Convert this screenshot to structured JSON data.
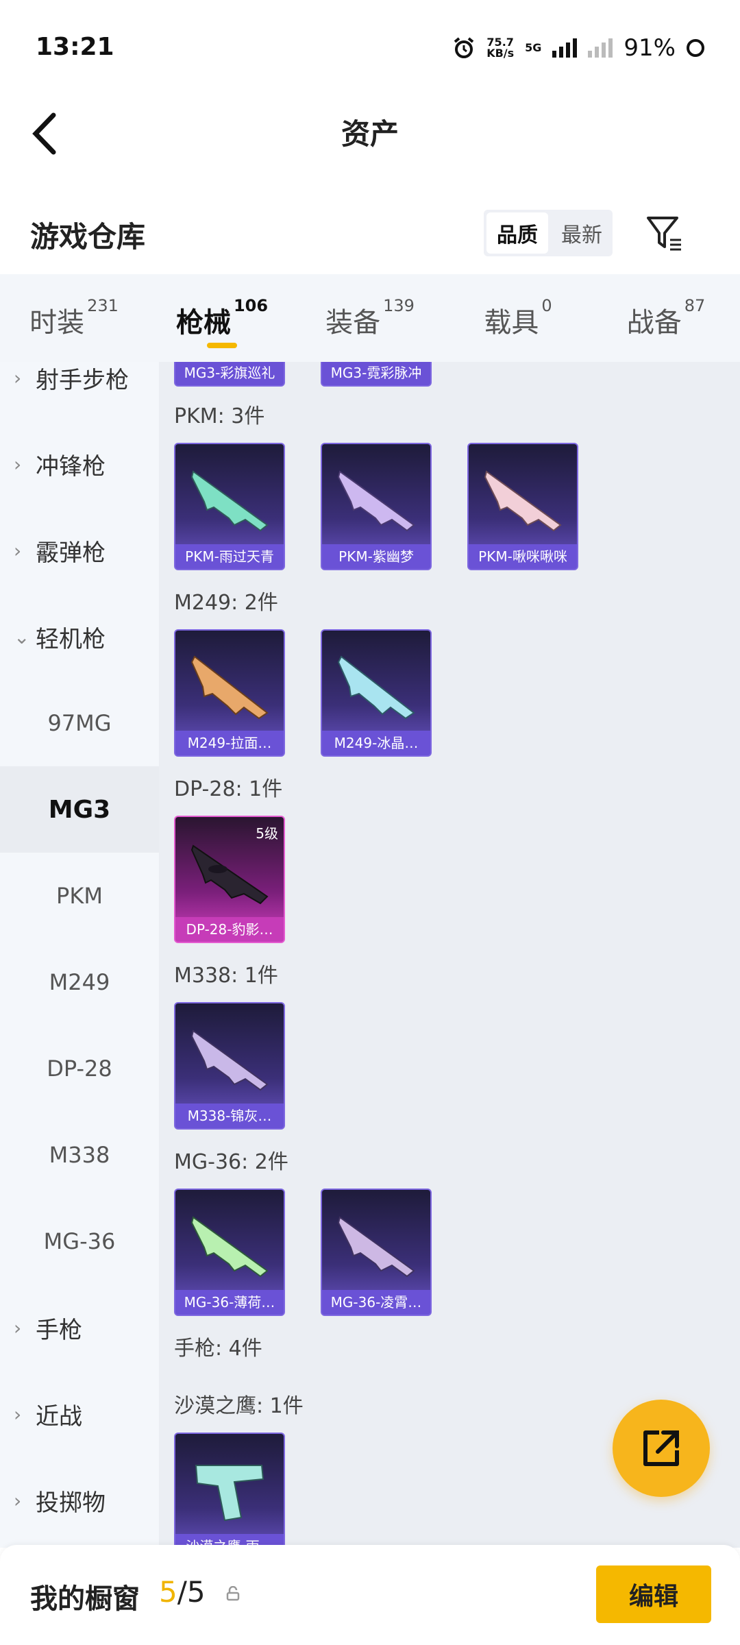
{
  "status": {
    "time": "13:21",
    "net_speed": "75.7",
    "net_unit": "KB/s",
    "network": "5G",
    "battery": "91%"
  },
  "header": {
    "title": "资产"
  },
  "section": {
    "title": "游戏仓库",
    "sort_quality": "品质",
    "sort_newest": "最新"
  },
  "tabs": [
    {
      "label": "时装",
      "count": "231"
    },
    {
      "label": "枪械",
      "count": "106"
    },
    {
      "label": "装备",
      "count": "139"
    },
    {
      "label": "载具",
      "count": "0"
    },
    {
      "label": "战备",
      "count": "87"
    }
  ],
  "sidebar": {
    "items": [
      {
        "label": "射手步枪",
        "type": "category",
        "arrow": "›"
      },
      {
        "label": "冲锋枪",
        "type": "category",
        "arrow": "›"
      },
      {
        "label": "霰弹枪",
        "type": "category",
        "arrow": "›"
      },
      {
        "label": "轻机枪",
        "type": "category",
        "arrow": "⌄"
      },
      {
        "label": "97MG",
        "type": "sub"
      },
      {
        "label": "MG3",
        "type": "sub",
        "active": true
      },
      {
        "label": "PKM",
        "type": "sub"
      },
      {
        "label": "M249",
        "type": "sub"
      },
      {
        "label": "DP-28",
        "type": "sub"
      },
      {
        "label": "M338",
        "type": "sub"
      },
      {
        "label": "MG-36",
        "type": "sub"
      },
      {
        "label": "手枪",
        "type": "category",
        "arrow": "›"
      },
      {
        "label": "近战",
        "type": "category",
        "arrow": "›"
      },
      {
        "label": "投掷物",
        "type": "category",
        "arrow": "›"
      }
    ]
  },
  "groups": [
    {
      "title": "",
      "items": [
        {
          "name": "MG3-彩旗巡礼"
        },
        {
          "name": "MG3-霓彩脉冲"
        }
      ]
    },
    {
      "title": "PKM: 3件",
      "items": [
        {
          "name": "PKM-雨过天青"
        },
        {
          "name": "PKM-紫幽梦"
        },
        {
          "name": "PKM-啾咪啾咪"
        }
      ]
    },
    {
      "title": "M249: 2件",
      "items": [
        {
          "name": "M249-拉面…"
        },
        {
          "name": "M249-冰晶…"
        }
      ]
    },
    {
      "title": "DP-28: 1件",
      "items": [
        {
          "name": "DP-28-豹影…",
          "level": "5级",
          "pink": true
        }
      ]
    },
    {
      "title": "M338: 1件",
      "items": [
        {
          "name": "M338-锦灰…"
        }
      ]
    },
    {
      "title": "MG-36: 2件",
      "items": [
        {
          "name": "MG-36-薄荷…"
        },
        {
          "name": "MG-36-凌霄…"
        }
      ]
    },
    {
      "title": "手枪: 4件",
      "items": []
    },
    {
      "title": "沙漠之鹰: 1件",
      "items": [
        {
          "name": "沙漠之鹰-雨…"
        }
      ]
    }
  ],
  "bottom": {
    "label": "我的橱窗",
    "count_used": "5",
    "count_sep": "/",
    "count_total": "5",
    "edit_label": "编辑"
  },
  "colors": {
    "accent": "#f5b800",
    "card_purple": "#6a52d6",
    "card_pink": "#c63cb8"
  }
}
